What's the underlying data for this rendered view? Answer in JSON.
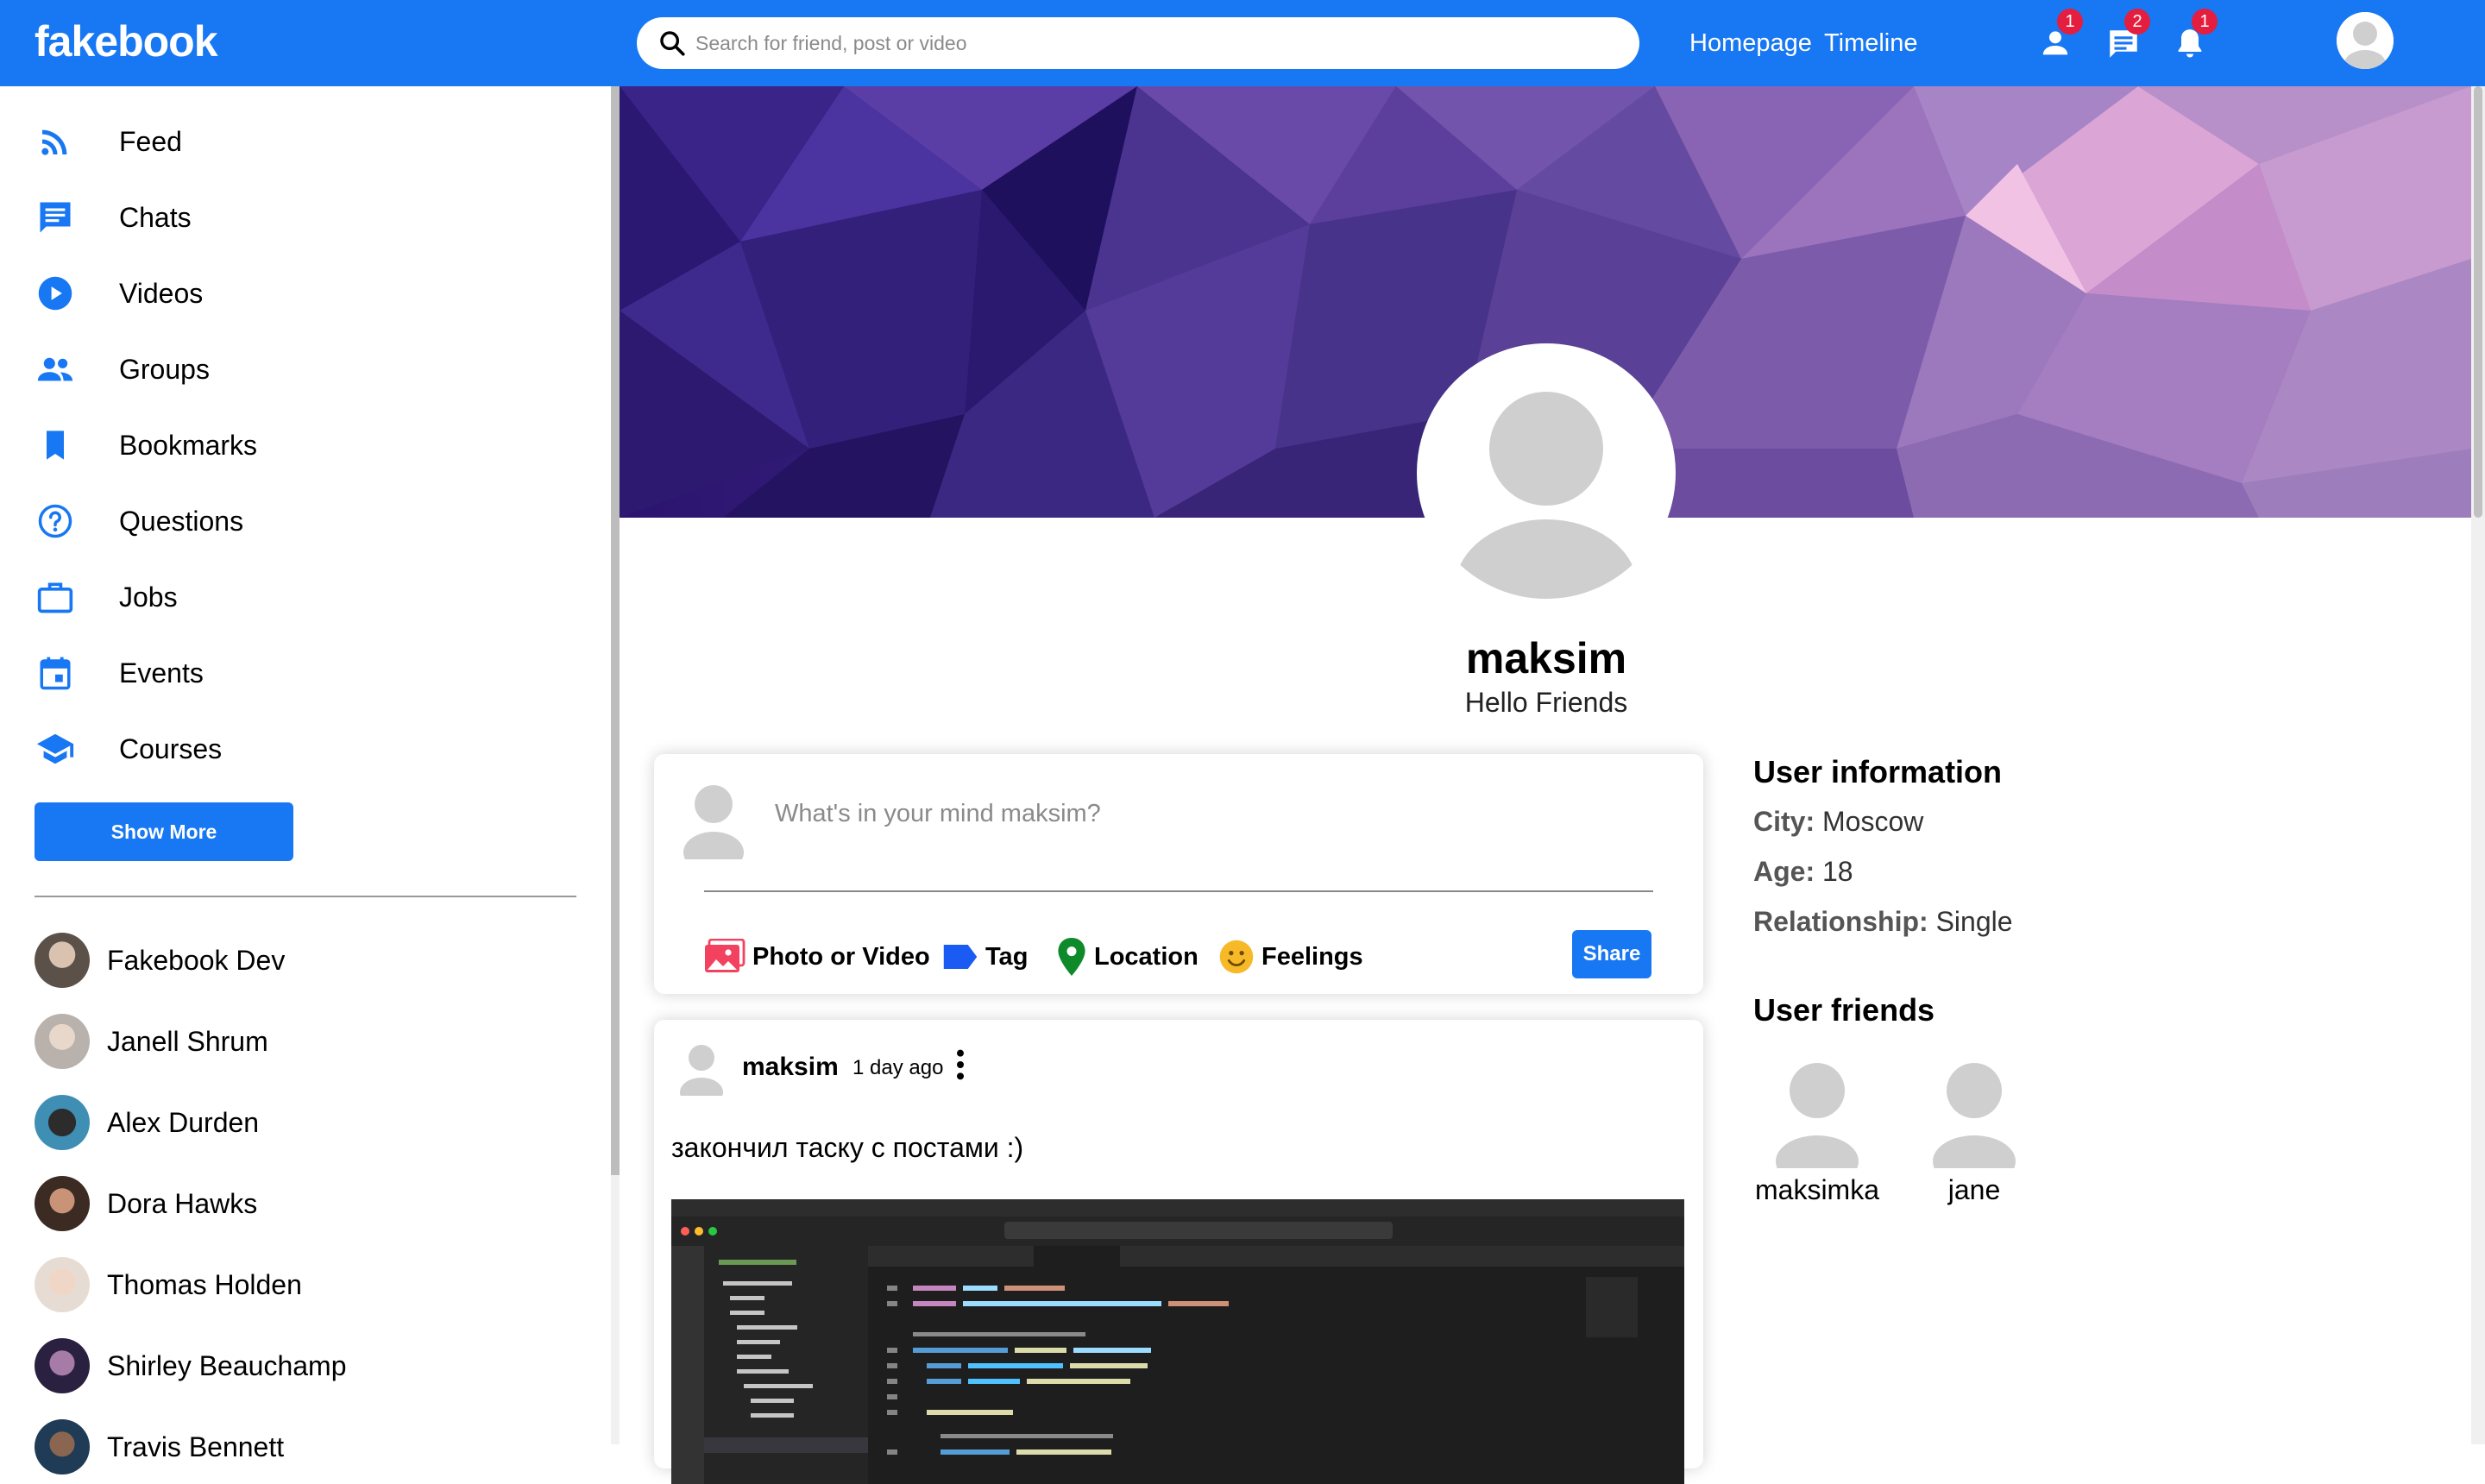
{
  "topbar": {
    "logo": "fakebook",
    "search_placeholder": "Search for friend, post or video",
    "links": [
      "Homepage",
      "Timeline"
    ],
    "icons": [
      {
        "name": "friend-requests-icon",
        "badge": "1"
      },
      {
        "name": "chat-icon",
        "badge": "2"
      },
      {
        "name": "notifications-icon",
        "badge": "1"
      }
    ],
    "brand_color": "#1877f2",
    "badge_color": "#e41e3f"
  },
  "sidebar": {
    "items": [
      {
        "label": "Feed",
        "icon": "rss-feed-icon"
      },
      {
        "label": "Chats",
        "icon": "chat-icon"
      },
      {
        "label": "Videos",
        "icon": "play-circle-icon"
      },
      {
        "label": "Groups",
        "icon": "groups-icon"
      },
      {
        "label": "Bookmarks",
        "icon": "bookmark-icon"
      },
      {
        "label": "Questions",
        "icon": "help-circle-icon"
      },
      {
        "label": "Jobs",
        "icon": "briefcase-icon"
      },
      {
        "label": "Events",
        "icon": "calendar-icon"
      },
      {
        "label": "Courses",
        "icon": "graduation-cap-icon"
      }
    ],
    "show_more": "Show More",
    "friends": [
      "Fakebook Dev",
      "Janell Shrum",
      "Alex Durden",
      "Dora Hawks",
      "Thomas Holden",
      "Shirley Beauchamp",
      "Travis Bennett"
    ]
  },
  "profile": {
    "name": "maksim",
    "description": "Hello Friends"
  },
  "share": {
    "placeholder": "What's in your mind maksim?",
    "options": [
      {
        "label": "Photo or Video",
        "icon": "photo-icon",
        "color": "#f3425f"
      },
      {
        "label": "Tag",
        "icon": "tag-icon",
        "color": "#1a5cf3"
      },
      {
        "label": "Location",
        "icon": "location-pin-icon",
        "color": "#0e8a2a"
      },
      {
        "label": "Feelings",
        "icon": "emoji-icon",
        "color": "#f7b928"
      }
    ],
    "button": "Share"
  },
  "post": {
    "username": "maksim",
    "date": "1 day ago",
    "text": "закончил таску с постами :)"
  },
  "user_info": {
    "title": "User information",
    "rows": [
      {
        "key": "City:",
        "value": "Moscow"
      },
      {
        "key": "Age:",
        "value": "18"
      },
      {
        "key": "Relationship:",
        "value": "Single"
      }
    ],
    "friends_title": "User friends",
    "friends": [
      "maksimka",
      "jane"
    ]
  }
}
